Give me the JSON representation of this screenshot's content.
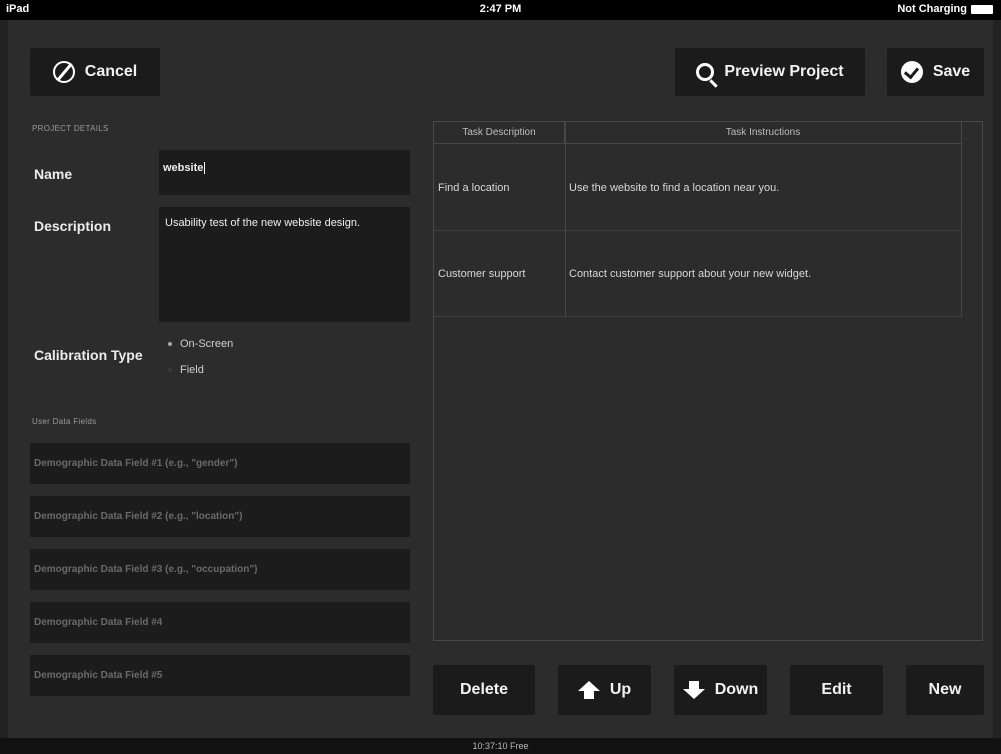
{
  "status_bar": {
    "device": "iPad",
    "time": "2:47 PM",
    "battery_status": "Not Charging"
  },
  "toolbar": {
    "cancel_label": "Cancel",
    "preview_label": "Preview Project",
    "save_label": "Save"
  },
  "project_details": {
    "section_label": "PROJECT DETAILS",
    "name_label": "Name",
    "name_value": "website",
    "description_label": "Description",
    "description_value": "Usability test of the new website design.",
    "calibration_label": "Calibration Type",
    "calibration_options": [
      {
        "label": "On-Screen",
        "selected": true
      },
      {
        "label": "Field",
        "selected": false
      }
    ]
  },
  "user_data": {
    "section_label": "User Data Fields",
    "fields": [
      {
        "placeholder": "Demographic Data Field #1 (e.g., \"gender\")"
      },
      {
        "placeholder": "Demographic Data Field #2 (e.g., \"location\")"
      },
      {
        "placeholder": "Demographic Data Field #3 (e.g., \"occupation\")"
      },
      {
        "placeholder": "Demographic Data Field #4"
      },
      {
        "placeholder": "Demographic Data Field #5"
      }
    ]
  },
  "tasks": {
    "columns": [
      "Task Description",
      "Task Instructions"
    ],
    "rows": [
      {
        "description": "Find a location",
        "instructions": "Use the website to find a location near you."
      },
      {
        "description": "Customer support",
        "instructions": "Contact customer support about your new widget."
      }
    ]
  },
  "actions": {
    "delete_label": "Delete",
    "up_label": "Up",
    "down_label": "Down",
    "edit_label": "Edit",
    "new_label": "New"
  },
  "footer": {
    "memory_text": "10:37:10 Free"
  }
}
